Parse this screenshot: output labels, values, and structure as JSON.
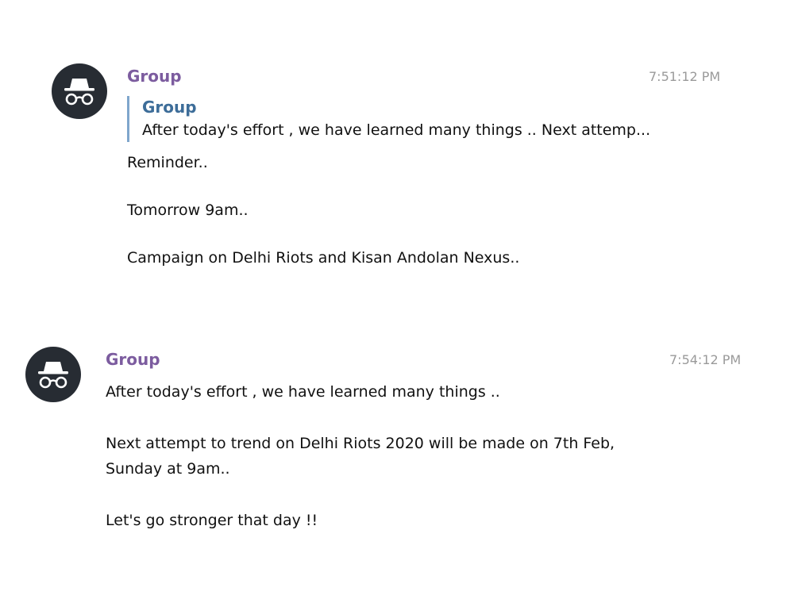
{
  "messages": [
    {
      "sender": "Group",
      "time": "7:51:12 PM",
      "avatar_icon": "incognito-icon",
      "reply": {
        "sender": "Group",
        "text": "After today's effort , we have learned many things .. Next attemp..."
      },
      "paragraphs": [
        "Reminder..",
        "Tomorrow 9am..",
        "Campaign on Delhi Riots and Kisan Andolan Nexus.."
      ]
    },
    {
      "sender": "Group",
      "time": "7:54:12 PM",
      "avatar_icon": "incognito-icon",
      "paragraphs": [
        "After today's effort , we have learned many things ..",
        "Next attempt to trend on Delhi Riots 2020 will be made on 7th Feb, Sunday at 9am..",
        "Let's go stronger that day !!"
      ]
    }
  ],
  "colors": {
    "sender": "#7c5c9f",
    "reply_sender": "#3d6d99",
    "reply_bar": "#7fa6cc",
    "avatar_bg": "#272c33",
    "time": "#9a9a9a"
  }
}
